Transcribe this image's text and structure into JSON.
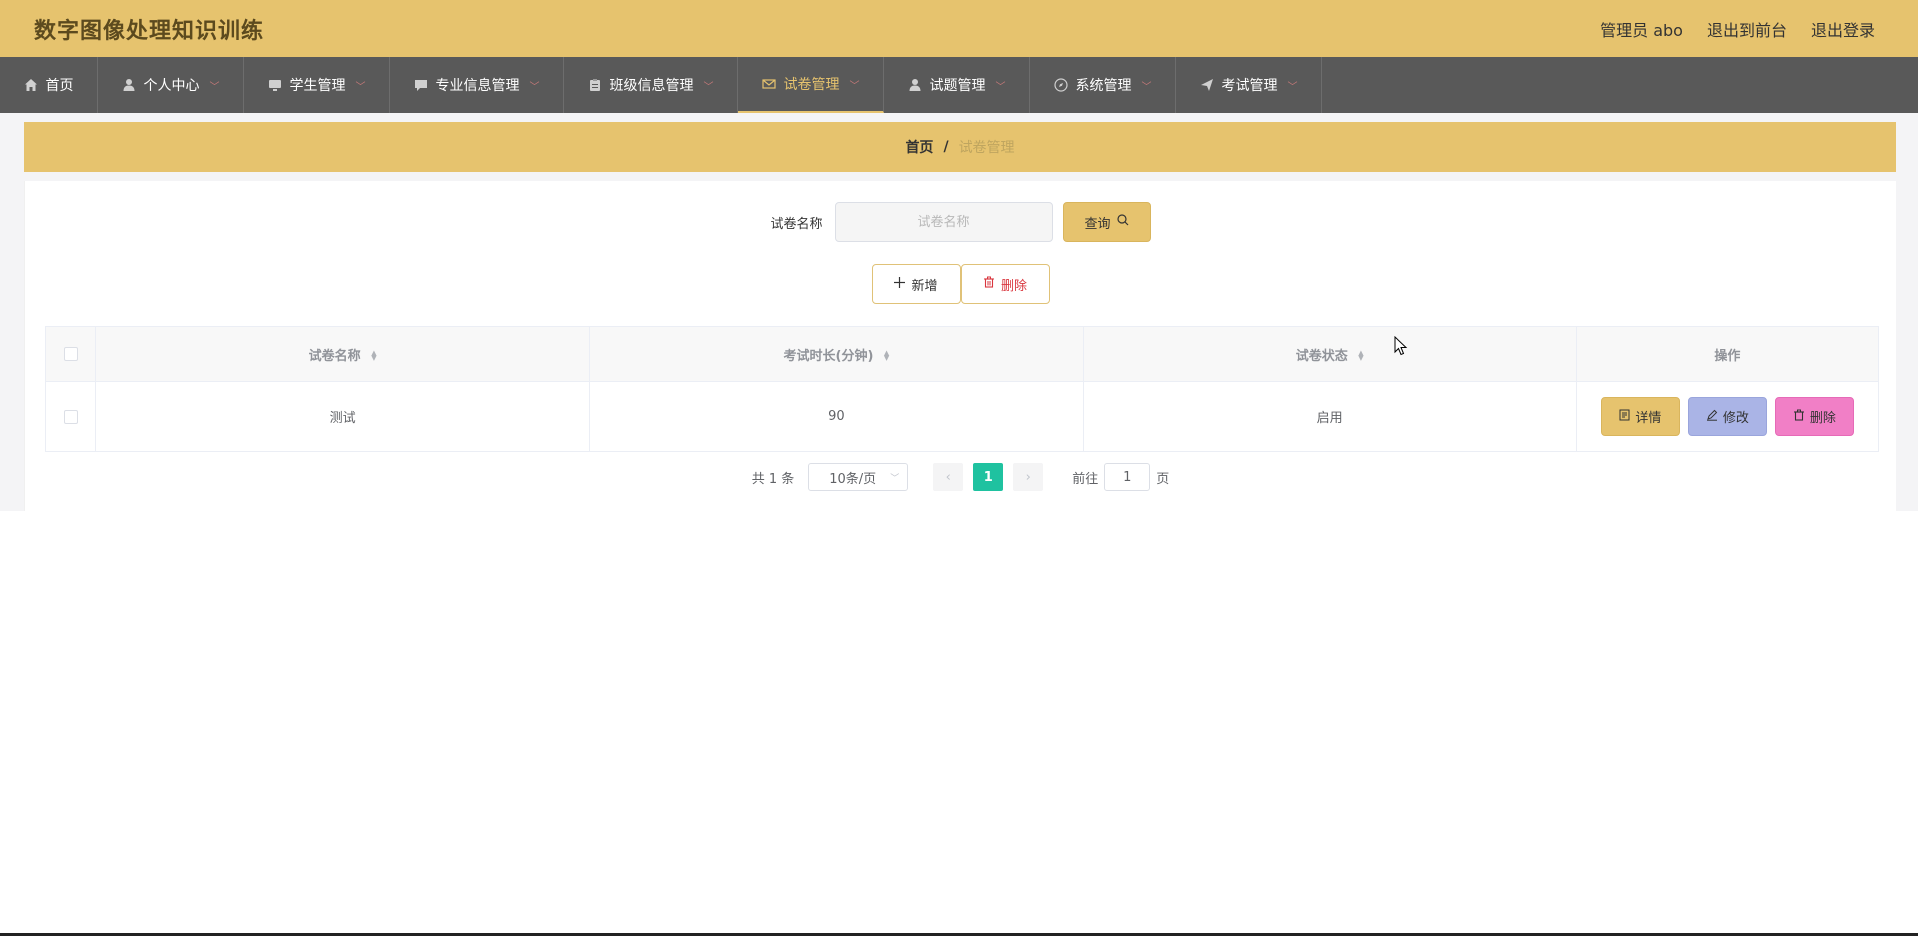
{
  "header": {
    "app_title": "数字图像处理知识训练",
    "user_label": "管理员 abo",
    "to_front": "退出到前台",
    "logout": "退出登录"
  },
  "nav": {
    "items": [
      {
        "label": "首页",
        "icon": "home-icon",
        "dropdown": false,
        "active": false
      },
      {
        "label": "个人中心",
        "icon": "user-icon",
        "dropdown": true,
        "active": false
      },
      {
        "label": "学生管理",
        "icon": "monitor-icon",
        "dropdown": true,
        "active": false
      },
      {
        "label": "专业信息管理",
        "icon": "chat-icon",
        "dropdown": true,
        "active": false
      },
      {
        "label": "班级信息管理",
        "icon": "clipboard-icon",
        "dropdown": true,
        "active": false
      },
      {
        "label": "试卷管理",
        "icon": "mail-icon",
        "dropdown": true,
        "active": true
      },
      {
        "label": "试题管理",
        "icon": "user-icon",
        "dropdown": true,
        "active": false
      },
      {
        "label": "系统管理",
        "icon": "compass-icon",
        "dropdown": true,
        "active": false
      },
      {
        "label": "考试管理",
        "icon": "send-icon",
        "dropdown": true,
        "active": false
      }
    ],
    "active_color": "#e6c36e"
  },
  "breadcrumb": {
    "home": "首页",
    "separator": "/",
    "current": "试卷管理"
  },
  "search": {
    "label": "试卷名称",
    "placeholder": "试卷名称",
    "value": "",
    "query_label": "查询"
  },
  "actions": {
    "add_label": "新增",
    "delete_label": "删除"
  },
  "table": {
    "columns": [
      "试卷名称",
      "考试时长(分钟)",
      "试卷状态",
      "操作"
    ],
    "rows": [
      {
        "name": "测试",
        "duration": "90",
        "status": "启用"
      }
    ],
    "row_actions": {
      "detail": "详情",
      "edit": "修改",
      "delete": "删除"
    }
  },
  "pagination": {
    "total": "共 1 条",
    "page_size": "10条/页",
    "current_page": "1",
    "goto_label": "前往",
    "goto_value": "1",
    "page_suffix": "页"
  },
  "colors": {
    "brand": "#e6c36e",
    "nav_bg": "#595959",
    "page_active": "#1fc2a0",
    "edit_btn": "#aab4e6",
    "delete_btn": "#f17fc6"
  }
}
